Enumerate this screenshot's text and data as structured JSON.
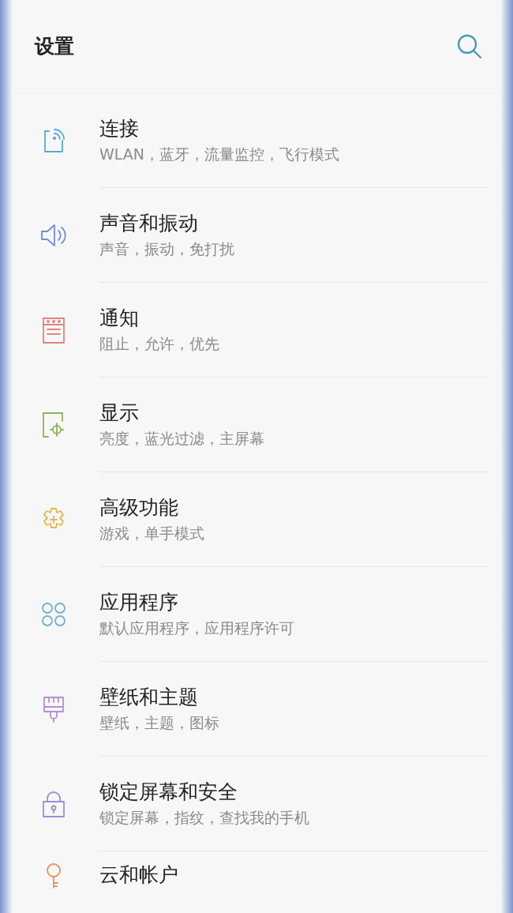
{
  "header": {
    "title": "设置"
  },
  "items": [
    {
      "kind": "connections",
      "color": "#5aa8d6",
      "title": "连接",
      "subtitle": "WLAN，蓝牙，流量监控，飞行模式"
    },
    {
      "kind": "sound",
      "color": "#6f8ed6",
      "title": "声音和振动",
      "subtitle": "声音，振动，免打扰"
    },
    {
      "kind": "notifications",
      "color": "#e48478",
      "title": "通知",
      "subtitle": "阻止，允许，优先"
    },
    {
      "kind": "display",
      "color": "#8fb35a",
      "title": "显示",
      "subtitle": "亮度，蓝光过滤，主屏幕"
    },
    {
      "kind": "advanced",
      "color": "#e6b84f",
      "title": "高级功能",
      "subtitle": "游戏，单手模式"
    },
    {
      "kind": "apps",
      "color": "#6fb0d6",
      "title": "应用程序",
      "subtitle": "默认应用程序，应用程序许可"
    },
    {
      "kind": "wallpaper",
      "color": "#b58fd0",
      "title": "壁纸和主题",
      "subtitle": "壁纸，主题，图标"
    },
    {
      "kind": "lock",
      "color": "#9d8fd8",
      "title": "锁定屏幕和安全",
      "subtitle": "锁定屏幕，指纹，查找我的手机"
    },
    {
      "kind": "accounts",
      "color": "#e8925a",
      "title": "云和帐户"
    }
  ]
}
